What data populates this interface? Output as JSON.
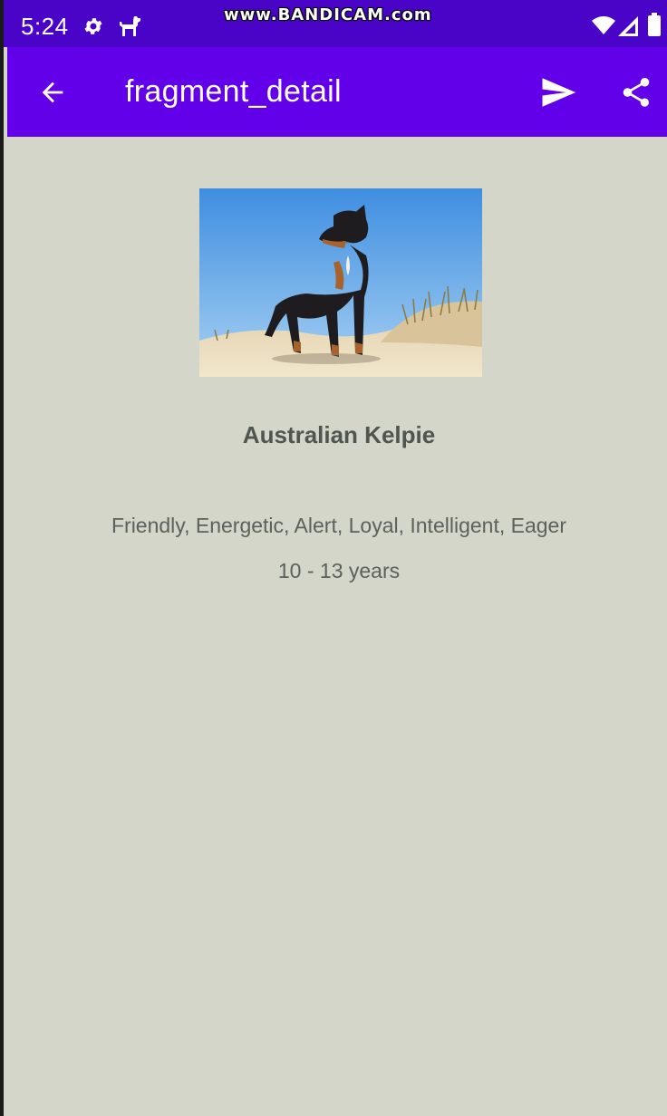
{
  "status_bar": {
    "time": "5:24",
    "watermark": "www.BANDICAM.com",
    "icons": [
      "gear-icon",
      "dog-icon",
      "wifi-icon",
      "signal-icon",
      "battery-icon"
    ]
  },
  "app_bar": {
    "title": "fragment_detail",
    "back_icon": "arrow-left-icon",
    "actions": [
      "send-icon",
      "share-icon"
    ],
    "background_color": "#6200ea"
  },
  "detail": {
    "name": "Australian Kelpie",
    "temperament": "Friendly, Energetic, Alert, Loyal, Intelligent, Eager",
    "life_span": "10 - 13 years"
  },
  "colors": {
    "status_bar": "#4a04c7",
    "app_bar": "#6200ea",
    "content_background": "#d3d6c9",
    "text": "#5b615b"
  }
}
